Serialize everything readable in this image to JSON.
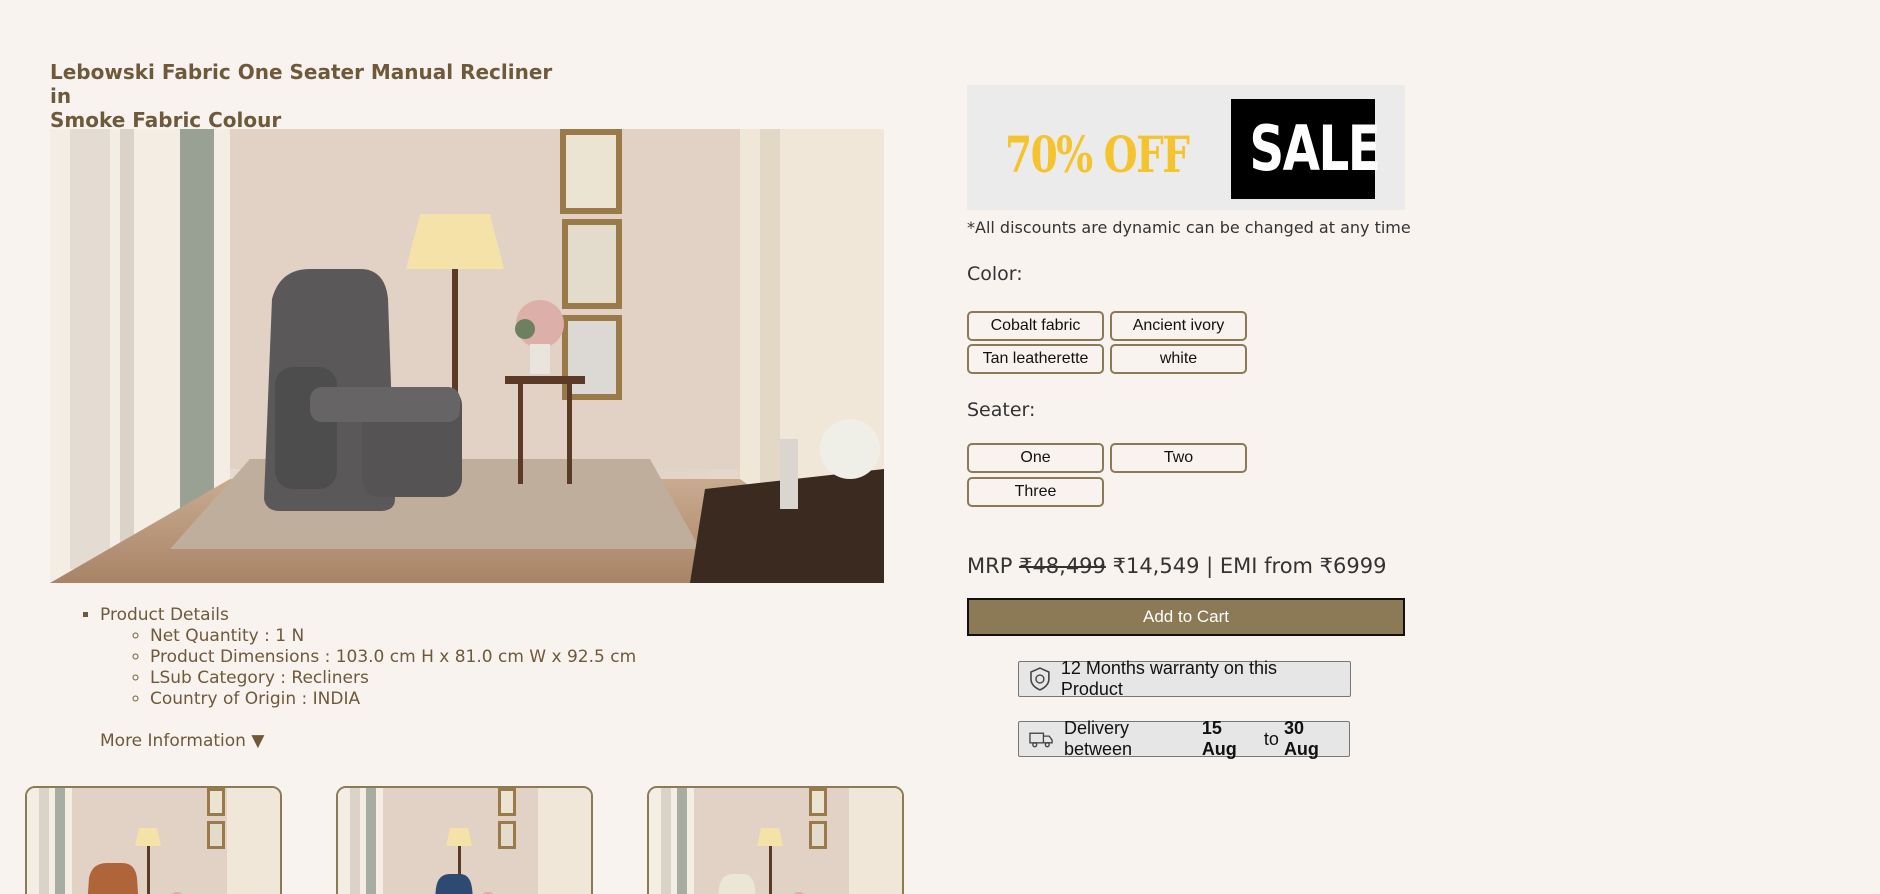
{
  "product": {
    "title_line1": "Lebowski Fabric One Seater Manual Recliner in",
    "title_line2": "Smoke Fabric Colour"
  },
  "details": {
    "heading": "Product Details",
    "items": [
      "Net Quantity : 1 N",
      "Product Dimensions : 103.0 cm H x 81.0 cm W x 92.5 cm",
      "LSub Category : Recliners",
      "Country of Origin : INDIA"
    ],
    "more_info": "More Information ▼"
  },
  "banner": {
    "percent": "70% OFF",
    "sale": "SALE",
    "disclaimer": "*All discounts are dynamic can be changed at any time"
  },
  "color": {
    "label": "Color:",
    "options": [
      "Cobalt fabric",
      "Ancient ivory",
      "Tan leatherette",
      "white"
    ]
  },
  "seater": {
    "label": "Seater:",
    "options": [
      "One",
      "Two",
      "Three"
    ]
  },
  "price": {
    "mrp_label": "MRP",
    "mrp": "₹48,499",
    "current": "₹14,549",
    "emi": "| EMI from ₹6999"
  },
  "cart": {
    "label": "Add to Cart"
  },
  "warranty": {
    "text": "12 Months warranty on this Product"
  },
  "delivery": {
    "prefix": "Delivery between",
    "from": "15 Aug",
    "mid": "to",
    "to": "30 Aug"
  },
  "thumbnails": {
    "chair_colors": [
      "#b0643a",
      "#2e4a72",
      "#ece6d6"
    ]
  },
  "colors": {
    "accent": "#8b7a55",
    "title": "#6e5a3a",
    "background": "#f8f3ef",
    "chair_main": "#5a5858"
  }
}
